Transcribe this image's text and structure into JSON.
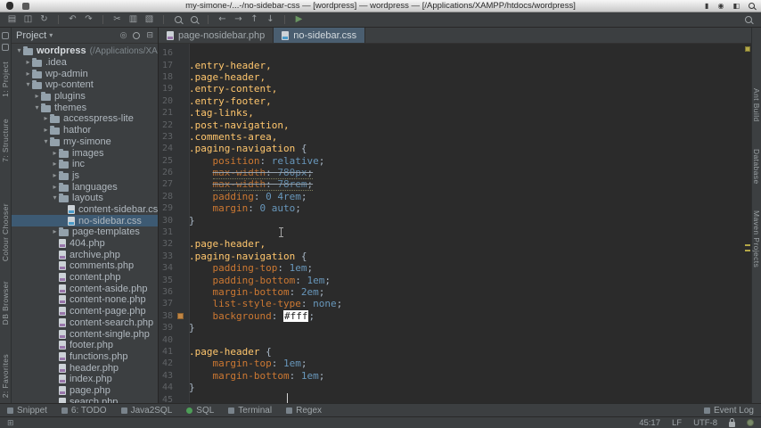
{
  "menubar": {
    "title": "my-simone-/...-/no-sidebar-css — [wordpress] — wordpress — [/Applications/XAMPP/htdocs/wordpress]"
  },
  "toolbar": {
    "icons": [
      {
        "name": "open",
        "glyph": "▤"
      },
      {
        "name": "save",
        "glyph": "◫"
      },
      {
        "name": "sync",
        "glyph": "↻"
      },
      {
        "sep": true
      },
      {
        "name": "undo",
        "glyph": "↶"
      },
      {
        "name": "redo",
        "glyph": "↷"
      },
      {
        "sep": true
      },
      {
        "name": "cut",
        "glyph": "✂"
      },
      {
        "name": "copy",
        "glyph": "▥"
      },
      {
        "name": "paste",
        "glyph": "▧"
      },
      {
        "sep": true
      },
      {
        "name": "find",
        "shape": "mag"
      },
      {
        "name": "replace",
        "shape": "mag"
      },
      {
        "sep": true
      },
      {
        "name": "back",
        "glyph": "←"
      },
      {
        "name": "forward",
        "glyph": "→"
      },
      {
        "name": "up",
        "glyph": "↑"
      },
      {
        "name": "down",
        "glyph": "↓"
      },
      {
        "sep": true
      },
      {
        "name": "run",
        "glyph": "▶",
        "color": "#6a9662"
      }
    ]
  },
  "left_strip": {
    "top": [
      "1: Project",
      "7: Structure"
    ],
    "middle": [
      "Colour Chooser",
      "DB Browser"
    ],
    "bottom": [
      "2: Favorites"
    ]
  },
  "right_strip": [
    "Ant Build",
    "Database",
    "Maven Projects"
  ],
  "project": {
    "title": "Project",
    "tree": [
      {
        "label": "wordpress",
        "path": "(/Applications/XAMPP/htdocs/wordpress)",
        "level": 0,
        "icon": "folder",
        "arrow": "down",
        "bold": true
      },
      {
        "label": ".idea",
        "level": 1,
        "icon": "folder",
        "arrow": "right"
      },
      {
        "label": "wp-admin",
        "level": 1,
        "icon": "folder",
        "arrow": "right"
      },
      {
        "label": "wp-content",
        "level": 1,
        "icon": "folder",
        "arrow": "down"
      },
      {
        "label": "plugins",
        "level": 2,
        "icon": "folder",
        "arrow": "right"
      },
      {
        "label": "themes",
        "level": 2,
        "icon": "folder",
        "arrow": "down"
      },
      {
        "label": "accesspress-lite",
        "level": 3,
        "icon": "folder",
        "arrow": "right"
      },
      {
        "label": "hathor",
        "level": 3,
        "icon": "folder",
        "arrow": "right"
      },
      {
        "label": "my-simone",
        "level": 3,
        "icon": "folder",
        "arrow": "down"
      },
      {
        "label": "images",
        "level": 4,
        "icon": "folder",
        "arrow": "right"
      },
      {
        "label": "inc",
        "level": 4,
        "icon": "folder",
        "arrow": "right"
      },
      {
        "label": "js",
        "level": 4,
        "icon": "folder",
        "arrow": "right"
      },
      {
        "label": "languages",
        "level": 4,
        "icon": "folder",
        "arrow": "right"
      },
      {
        "label": "layouts",
        "level": 4,
        "icon": "folder",
        "arrow": "down"
      },
      {
        "label": "content-sidebar.css",
        "level": 5,
        "icon": "css"
      },
      {
        "label": "no-sidebar.css",
        "level": 5,
        "icon": "css",
        "selected": true
      },
      {
        "label": "page-templates",
        "level": 4,
        "icon": "folder",
        "arrow": "right"
      },
      {
        "label": "404.php",
        "level": 4,
        "icon": "php"
      },
      {
        "label": "archive.php",
        "level": 4,
        "icon": "php"
      },
      {
        "label": "comments.php",
        "level": 4,
        "icon": "php"
      },
      {
        "label": "content.php",
        "level": 4,
        "icon": "php"
      },
      {
        "label": "content-aside.php",
        "level": 4,
        "icon": "php"
      },
      {
        "label": "content-none.php",
        "level": 4,
        "icon": "php"
      },
      {
        "label": "content-page.php",
        "level": 4,
        "icon": "php"
      },
      {
        "label": "content-search.php",
        "level": 4,
        "icon": "php"
      },
      {
        "label": "content-single.php",
        "level": 4,
        "icon": "php"
      },
      {
        "label": "footer.php",
        "level": 4,
        "icon": "php"
      },
      {
        "label": "functions.php",
        "level": 4,
        "icon": "php"
      },
      {
        "label": "header.php",
        "level": 4,
        "icon": "php"
      },
      {
        "label": "index.php",
        "level": 4,
        "icon": "php"
      },
      {
        "label": "page.php",
        "level": 4,
        "icon": "php"
      },
      {
        "label": "search.php",
        "level": 4,
        "icon": "php"
      }
    ]
  },
  "tabs": [
    {
      "label": "page-nosidebar.php",
      "type": "php",
      "active": false
    },
    {
      "label": "no-sidebar.css",
      "type": "css",
      "active": true
    }
  ],
  "editor": {
    "lines": [
      {
        "n": 16,
        "t": []
      },
      {
        "n": 17,
        "t": [
          {
            "s": ".entry-header,",
            "c": "sel"
          }
        ]
      },
      {
        "n": 18,
        "t": [
          {
            "s": ".page-header,",
            "c": "sel"
          }
        ]
      },
      {
        "n": 19,
        "t": [
          {
            "s": ".entry-content,",
            "c": "sel"
          }
        ]
      },
      {
        "n": 20,
        "t": [
          {
            "s": ".entry-footer,",
            "c": "sel"
          }
        ]
      },
      {
        "n": 21,
        "t": [
          {
            "s": ".tag-links,",
            "c": "sel"
          }
        ]
      },
      {
        "n": 22,
        "t": [
          {
            "s": ".post-navigation,",
            "c": "sel"
          }
        ]
      },
      {
        "n": 23,
        "t": [
          {
            "s": ".comments-area,",
            "c": "sel"
          }
        ]
      },
      {
        "n": 24,
        "t": [
          {
            "s": ".paging-navigation ",
            "c": "sel"
          },
          {
            "s": "{",
            "c": "pln"
          }
        ]
      },
      {
        "n": 25,
        "t": [
          {
            "s": "    ",
            "c": "pln"
          },
          {
            "s": "position",
            "c": "prop"
          },
          {
            "s": ": ",
            "c": "pln"
          },
          {
            "s": "relative",
            "c": "val"
          },
          {
            "s": ";",
            "c": "pln"
          }
        ]
      },
      {
        "n": 26,
        "dup": true,
        "t": [
          {
            "s": "    ",
            "c": "pln"
          },
          {
            "s": "max-width",
            "c": "prop"
          },
          {
            "s": ": ",
            "c": "pln"
          },
          {
            "s": "780px",
            "c": "val"
          },
          {
            "s": ";",
            "c": "pln"
          }
        ]
      },
      {
        "n": 27,
        "dup": true,
        "t": [
          {
            "s": "    ",
            "c": "pln"
          },
          {
            "s": "max-width",
            "c": "prop"
          },
          {
            "s": ": ",
            "c": "pln"
          },
          {
            "s": "78rem",
            "c": "val"
          },
          {
            "s": ";",
            "c": "pln"
          }
        ]
      },
      {
        "n": 28,
        "t": [
          {
            "s": "    ",
            "c": "pln"
          },
          {
            "s": "padding",
            "c": "prop"
          },
          {
            "s": ": ",
            "c": "pln"
          },
          {
            "s": "0 4rem",
            "c": "val"
          },
          {
            "s": ";",
            "c": "pln"
          }
        ]
      },
      {
        "n": 29,
        "t": [
          {
            "s": "    ",
            "c": "pln"
          },
          {
            "s": "margin",
            "c": "prop"
          },
          {
            "s": ": ",
            "c": "pln"
          },
          {
            "s": "0 auto",
            "c": "val"
          },
          {
            "s": ";",
            "c": "pln"
          }
        ]
      },
      {
        "n": 30,
        "t": [
          {
            "s": "}",
            "c": "pln"
          }
        ]
      },
      {
        "n": 31,
        "t": []
      },
      {
        "n": 32,
        "t": [
          {
            "s": ".page-header,",
            "c": "sel"
          }
        ]
      },
      {
        "n": 33,
        "t": [
          {
            "s": ".paging-navigation ",
            "c": "sel"
          },
          {
            "s": "{",
            "c": "pln"
          }
        ]
      },
      {
        "n": 34,
        "t": [
          {
            "s": "    ",
            "c": "pln"
          },
          {
            "s": "padding-top",
            "c": "prop"
          },
          {
            "s": ": ",
            "c": "pln"
          },
          {
            "s": "1em",
            "c": "val"
          },
          {
            "s": ";",
            "c": "pln"
          }
        ]
      },
      {
        "n": 35,
        "t": [
          {
            "s": "    ",
            "c": "pln"
          },
          {
            "s": "padding-bottom",
            "c": "prop"
          },
          {
            "s": ": ",
            "c": "pln"
          },
          {
            "s": "1em",
            "c": "val"
          },
          {
            "s": ";",
            "c": "pln"
          }
        ]
      },
      {
        "n": 36,
        "t": [
          {
            "s": "    ",
            "c": "pln"
          },
          {
            "s": "margin-bottom",
            "c": "prop"
          },
          {
            "s": ": ",
            "c": "pln"
          },
          {
            "s": "2em",
            "c": "val"
          },
          {
            "s": ";",
            "c": "pln"
          }
        ]
      },
      {
        "n": 37,
        "t": [
          {
            "s": "    ",
            "c": "pln"
          },
          {
            "s": "list-style-type",
            "c": "prop"
          },
          {
            "s": ": ",
            "c": "pln"
          },
          {
            "s": "none",
            "c": "val"
          },
          {
            "s": ";",
            "c": "pln"
          }
        ]
      },
      {
        "n": 38,
        "mark": "swatch",
        "t": [
          {
            "s": "    ",
            "c": "pln"
          },
          {
            "s": "background",
            "c": "prop"
          },
          {
            "s": ": ",
            "c": "pln"
          },
          {
            "s": "#fff",
            "c": "hl"
          },
          {
            "s": ";",
            "c": "pln"
          }
        ]
      },
      {
        "n": 39,
        "t": [
          {
            "s": "}",
            "c": "pln"
          }
        ]
      },
      {
        "n": 40,
        "t": []
      },
      {
        "n": 41,
        "t": [
          {
            "s": ".page-header ",
            "c": "sel"
          },
          {
            "s": "{",
            "c": "pln"
          }
        ]
      },
      {
        "n": 42,
        "t": [
          {
            "s": "    ",
            "c": "pln"
          },
          {
            "s": "margin-top",
            "c": "prop"
          },
          {
            "s": ": ",
            "c": "pln"
          },
          {
            "s": "1em",
            "c": "val"
          },
          {
            "s": ";",
            "c": "pln"
          }
        ]
      },
      {
        "n": 43,
        "t": [
          {
            "s": "    ",
            "c": "pln"
          },
          {
            "s": "margin-bottom",
            "c": "prop"
          },
          {
            "s": ": ",
            "c": "pln"
          },
          {
            "s": "1em",
            "c": "val"
          },
          {
            "s": ";",
            "c": "pln"
          }
        ]
      },
      {
        "n": 44,
        "t": [
          {
            "s": "}",
            "c": "pln"
          }
        ]
      },
      {
        "n": 45,
        "t": []
      }
    ]
  },
  "bottom_panel": {
    "left": [
      {
        "label": "Snippet",
        "icon": "snippet"
      },
      {
        "label": "6: TODO",
        "icon": "todo"
      },
      {
        "label": "Java2SQL",
        "icon": "java2sql"
      },
      {
        "label": "SQL",
        "icon": "sql"
      },
      {
        "label": "Terminal",
        "icon": "terminal"
      },
      {
        "label": "Regex",
        "icon": "regex"
      }
    ],
    "right": [
      {
        "label": "Event Log",
        "icon": "event-log"
      }
    ]
  },
  "statusbar": {
    "position": "45:17",
    "line_separator": "LF",
    "encoding": "UTF-8"
  },
  "colors": {
    "selection": "#3d5a73",
    "editor_bg": "#2b2b2b",
    "panel_bg": "#3c3f41",
    "selector": "#ffc66d",
    "property": "#cc7832",
    "value": "#6897bb",
    "warning_stripe": "#b3a747"
  }
}
